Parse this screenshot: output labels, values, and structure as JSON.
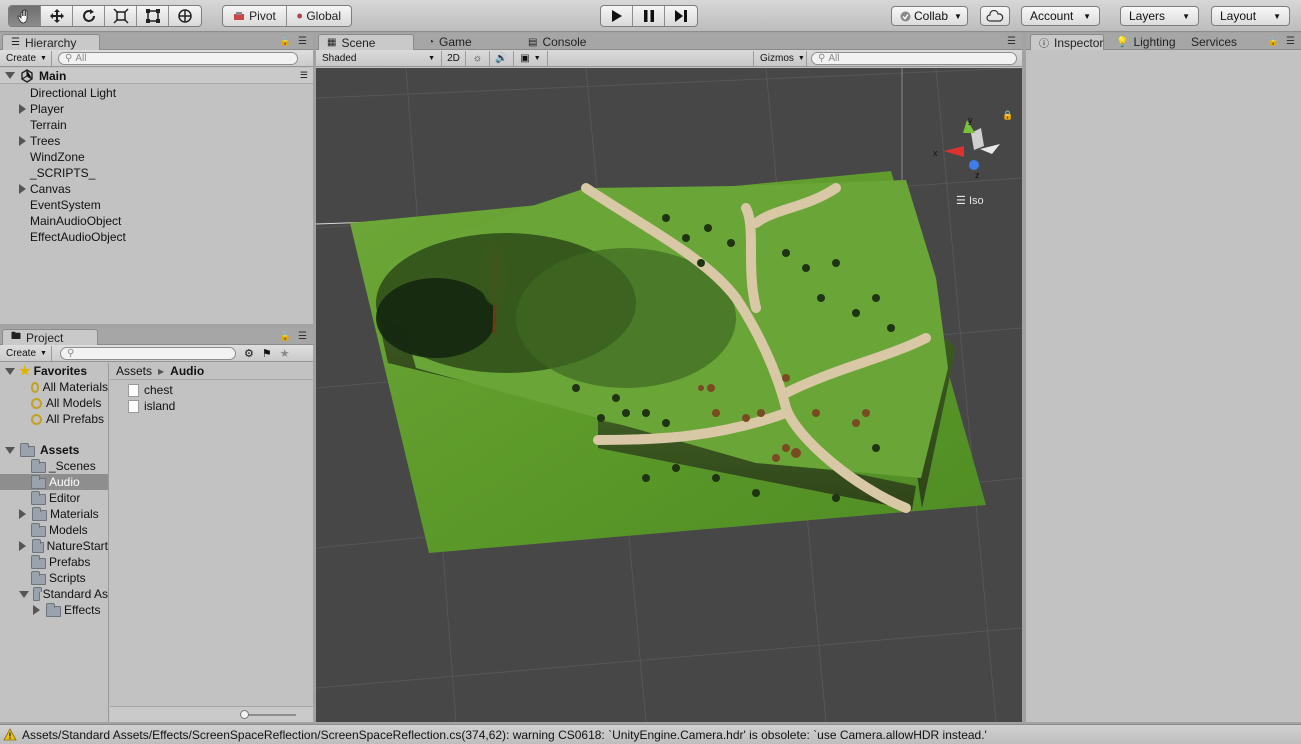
{
  "toolbar": {
    "tools": [
      "hand-tool",
      "move-tool",
      "rotate-tool",
      "scale-tool",
      "rect-tool",
      "transform-tool"
    ],
    "pivot_label": "Pivot",
    "global_label": "Global",
    "collab_label": "Collab",
    "account_label": "Account",
    "layers_label": "Layers",
    "layout_label": "Layout"
  },
  "hierarchy": {
    "tab_label": "Hierarchy",
    "create_label": "Create",
    "search_placeholder": "All",
    "scene_name": "Main",
    "items": [
      {
        "label": "Directional Light",
        "expandable": false
      },
      {
        "label": "Player",
        "expandable": true
      },
      {
        "label": "Terrain",
        "expandable": false
      },
      {
        "label": "Trees",
        "expandable": true
      },
      {
        "label": "WindZone",
        "expandable": false
      },
      {
        "label": "_SCRIPTS_",
        "expandable": false
      },
      {
        "label": "Canvas",
        "expandable": true
      },
      {
        "label": "EventSystem",
        "expandable": false
      },
      {
        "label": "MainAudioObject",
        "expandable": false
      },
      {
        "label": "EffectAudioObject",
        "expandable": false
      }
    ]
  },
  "project": {
    "tab_label": "Project",
    "create_label": "Create",
    "favorites_label": "Favorites",
    "favorites": [
      "All Materials",
      "All Models",
      "All Prefabs"
    ],
    "assets_label": "Assets",
    "folders": [
      {
        "label": "_Scenes",
        "expandable": false,
        "indent": 1
      },
      {
        "label": "Audio",
        "expandable": false,
        "indent": 1,
        "selected": true
      },
      {
        "label": "Editor",
        "expandable": false,
        "indent": 1
      },
      {
        "label": "Materials",
        "expandable": true,
        "indent": 1
      },
      {
        "label": "Models",
        "expandable": false,
        "indent": 1
      },
      {
        "label": "NatureStart",
        "expandable": true,
        "indent": 1
      },
      {
        "label": "Prefabs",
        "expandable": false,
        "indent": 1
      },
      {
        "label": "Scripts",
        "expandable": false,
        "indent": 1
      },
      {
        "label": "Standard As",
        "expandable": true,
        "open": true,
        "indent": 1
      },
      {
        "label": "Effects",
        "expandable": true,
        "indent": 2
      }
    ],
    "breadcrumb": {
      "root": "Assets",
      "current": "Audio"
    },
    "files": [
      "chest",
      "island"
    ]
  },
  "scene": {
    "tabs": [
      {
        "label": "Scene",
        "active": true,
        "icon": "grid-icon"
      },
      {
        "label": "Game",
        "active": false,
        "icon": "pacman-icon"
      },
      {
        "label": "Console",
        "active": false,
        "icon": "console-icon"
      }
    ],
    "shading_mode": "Shaded",
    "mode_2d": "2D",
    "gizmos_label": "Gizmos",
    "search_placeholder": "All",
    "projection_label": "Iso",
    "axis_labels": {
      "x": "x",
      "y": "y",
      "z": "z"
    }
  },
  "inspector": {
    "tabs": [
      "Inspector",
      "Lighting",
      "Services"
    ]
  },
  "status": {
    "message": "Assets/Standard Assets/Effects/ScreenSpaceReflection/ScreenSpaceReflection.cs(374,62): warning CS0618: `UnityEngine.Camera.hdr' is obsolete: `use Camera.allowHDR instead.'"
  },
  "colors": {
    "terrain_grass": "#5f9a2c",
    "path_sand": "#d9c8a6",
    "scene_bg": "#474747",
    "selection": "#8e8e8e"
  }
}
